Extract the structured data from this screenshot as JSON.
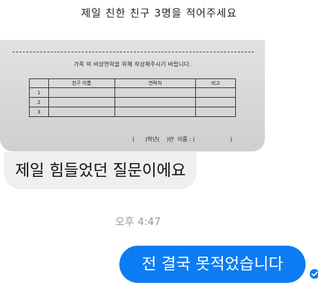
{
  "heading": "제일 친한 친구 3명을 적어주세요",
  "form": {
    "title": "가족 외 비상연락을 위해 작성해주시기 바랍니다.",
    "columns": [
      "",
      "친구 이름",
      "연락처",
      "비고"
    ],
    "rows": [
      "1",
      "2",
      "3"
    ],
    "signature": "(      )학년(    )반  이름 : (                    )"
  },
  "messages": {
    "incoming": "제일 힘들었던 질문이에요",
    "timestamp": "오후 4:47",
    "outgoing": "전 결국 못적었습니다"
  },
  "colors": {
    "outgoing_bubble": "#0d7cf2",
    "incoming_bubble": "#efefef",
    "timestamp": "#9a9a9a"
  },
  "icons": {
    "read_receipt": "check-circle-icon"
  }
}
